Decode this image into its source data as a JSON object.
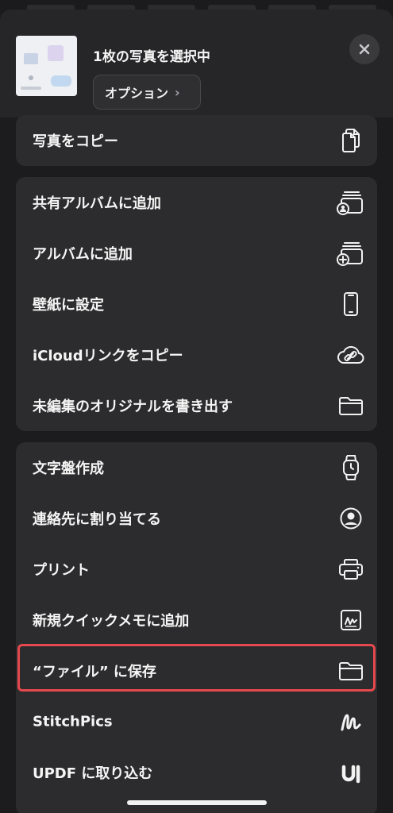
{
  "header": {
    "title": "1枚の写真を選択中",
    "options_label": "オプション",
    "options_chevron": "›",
    "close_icon": "close-icon"
  },
  "group_copy": [
    {
      "label": "写真をコピー",
      "icon": "copy-icon"
    }
  ],
  "group_album": [
    {
      "label": "共有アルバムに追加",
      "icon": "shared-album-icon"
    },
    {
      "label": "アルバムに追加",
      "icon": "add-album-icon"
    },
    {
      "label": "壁紙に設定",
      "icon": "phone-icon"
    },
    {
      "label": "iCloudリンクをコピー",
      "icon": "cloud-link-icon"
    },
    {
      "label": "未編集のオリジナルを書き出す",
      "icon": "folder-icon"
    }
  ],
  "group_actions": [
    {
      "label": "文字盤作成",
      "icon": "watch-icon"
    },
    {
      "label": "連絡先に割り当てる",
      "icon": "person-circle-icon"
    },
    {
      "label": "プリント",
      "icon": "printer-icon"
    },
    {
      "label": "新規クイックメモに追加",
      "icon": "quick-note-icon"
    },
    {
      "label": "“ファイル” に保存",
      "icon": "folder-icon",
      "highlighted": true
    },
    {
      "label": "StitchPics",
      "icon": "stitchpics-app-icon"
    },
    {
      "label": "UPDF に取り込む",
      "icon": "updf-app-icon"
    }
  ],
  "colors": {
    "sheet": "#1c1c1e",
    "group": "#2c2c2e",
    "highlight": "#e5484d"
  }
}
